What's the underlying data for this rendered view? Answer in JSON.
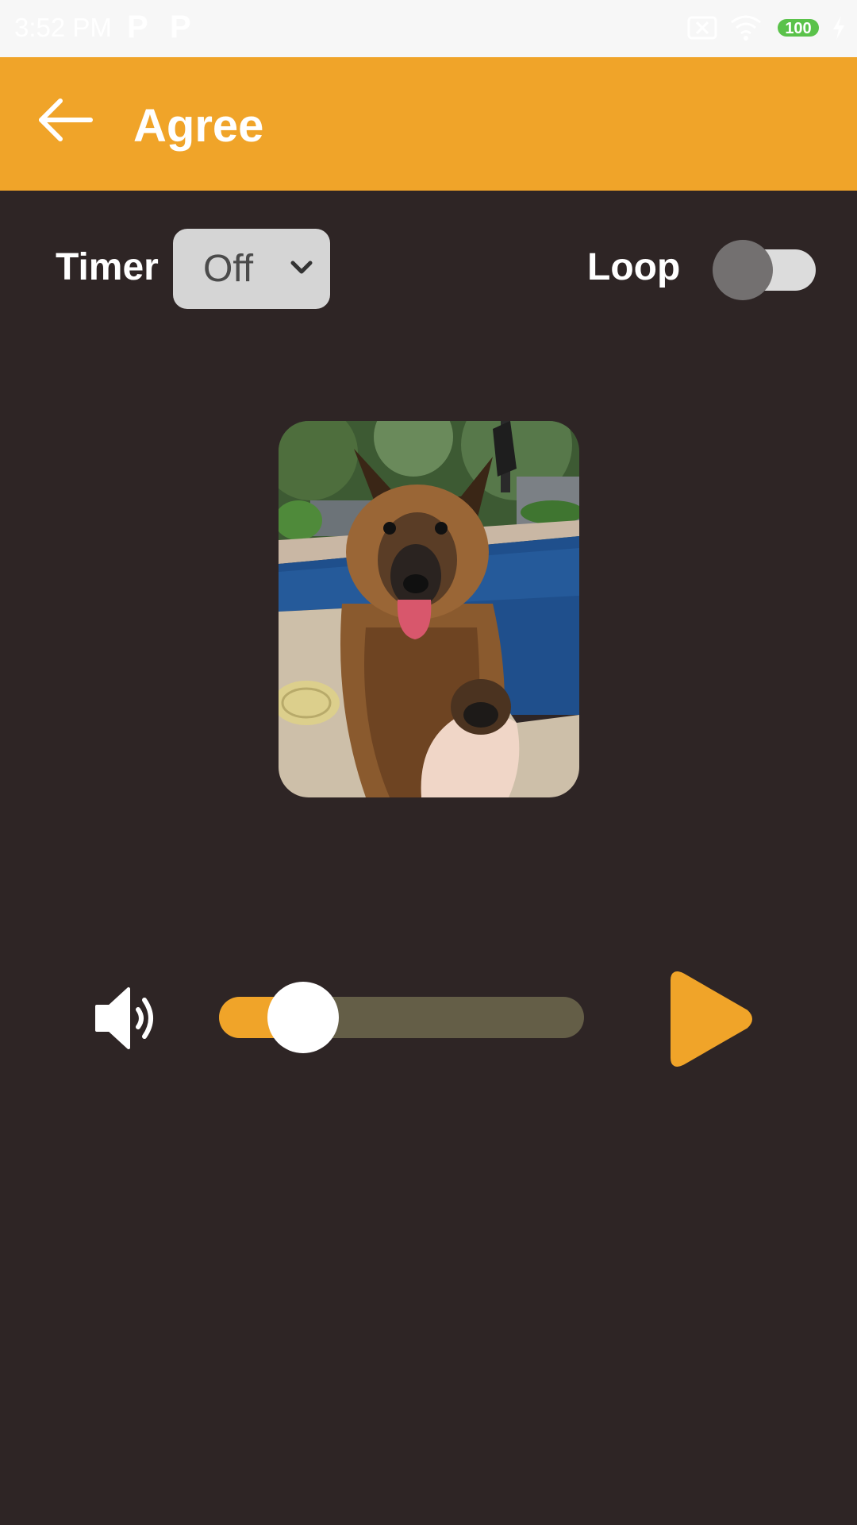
{
  "status_bar": {
    "time": "3:52 PM",
    "notification_icons": [
      "P",
      "P"
    ],
    "battery": "100",
    "icons": [
      "no-sim-icon",
      "wifi-icon",
      "battery-icon",
      "charging-icon"
    ]
  },
  "app_bar": {
    "title": "Agree",
    "back_icon": "arrow-left-icon",
    "color": "#f0a429"
  },
  "controls": {
    "timer_label": "Timer",
    "timer_value": "Off",
    "loop_label": "Loop",
    "loop_on": false
  },
  "media": {
    "image_description_icon": "dog-photo",
    "volume_icon": "volume-icon",
    "volume_level": 0.23,
    "play_icon": "play-icon"
  },
  "colors": {
    "background": "#2e2525",
    "accent": "#f0a429",
    "slider_track": "#645e47",
    "toggle_track": "#dcdcdc",
    "toggle_thumb": "#737070"
  }
}
